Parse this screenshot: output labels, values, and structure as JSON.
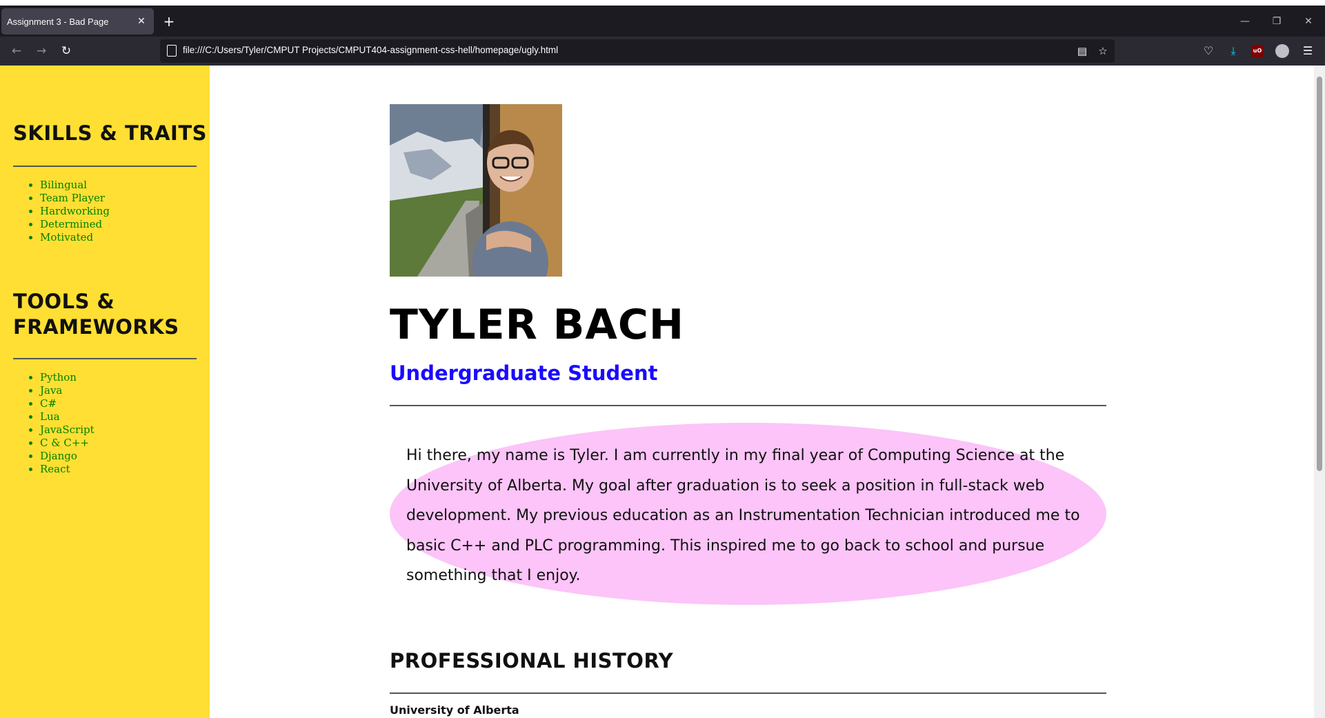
{
  "browser": {
    "tab_title": "Assignment 3 - Bad Page",
    "url": "file:///C:/Users/Tyler/CMPUT Projects/CMPUT404-assignment-css-hell/homepage/ugly.html"
  },
  "sidebar": {
    "skills_heading": "SKILLS & TRAITS",
    "skills": [
      "Bilingual",
      "Team Player",
      "Hardworking",
      "Determined",
      "Motivated"
    ],
    "tools_heading_line1": "TOOLS &",
    "tools_heading_line2": "FRAMEWORKS",
    "tools": [
      "Python",
      "Java",
      "C#",
      "Lua",
      "JavaScript",
      "C & C++",
      "Django",
      "React"
    ]
  },
  "main": {
    "name": "TYLER BACH",
    "subtitle": "Undergraduate Student",
    "bio": "Hi there, my name is Tyler. I am currently in my final year of Computing Science at the University of Alberta. My goal after graduation is to seek a position in full-stack web development. My previous education as an Instrumentation Technician introduced me to basic C++ and PLC programming. This inspired me to go back to school and pursue something that I enjoy.",
    "history_heading": "PROFESSIONAL HISTORY",
    "first_employer": "University of Alberta"
  },
  "colors": {
    "sidebar_bg": "#ffdf33",
    "list_text": "#008000",
    "subtitle": "#1a0aff",
    "bio_bg": "#fcc4f8"
  }
}
